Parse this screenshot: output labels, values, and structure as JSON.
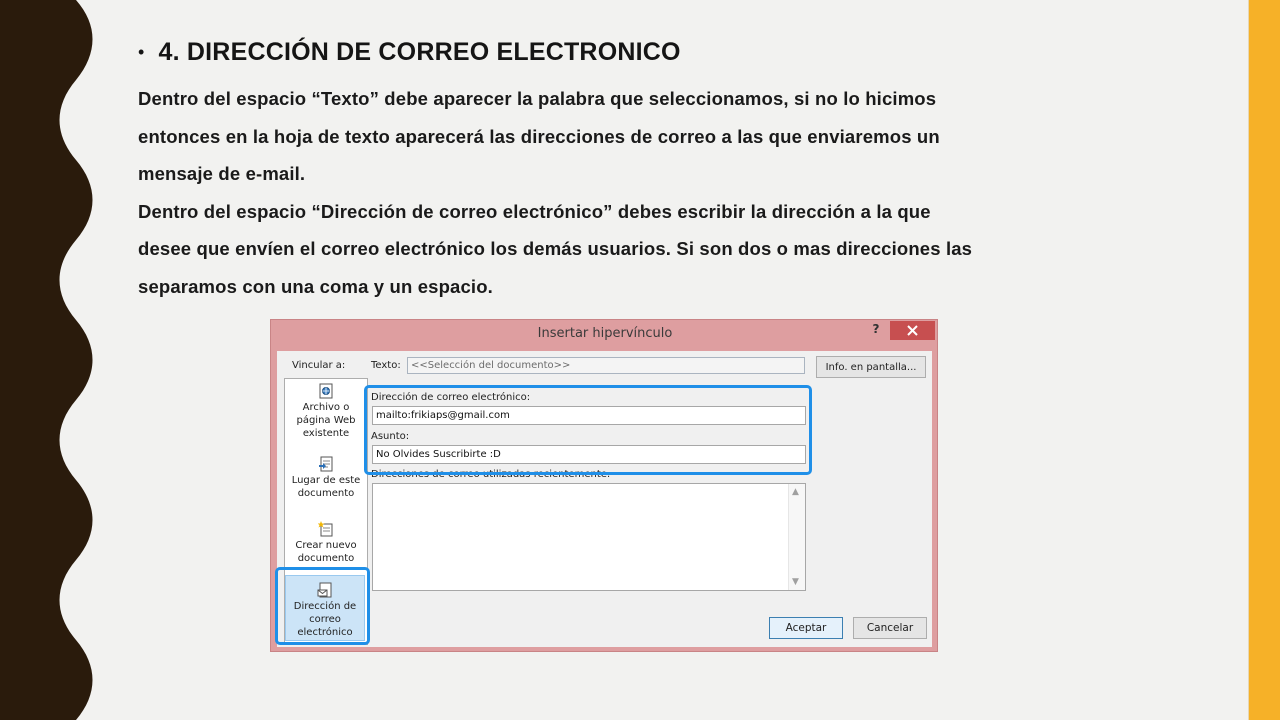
{
  "slide": {
    "heading_bullet": "•",
    "heading": "4. DIRECCIÓN DE CORREO ELECTRONICO",
    "paragraph1_lines": [
      "Dentro del espacio “Texto” debe aparecer la palabra que seleccionamos, si no lo hicimos",
      "entonces en la hoja de texto aparecerá las direcciones de correo a las que enviaremos un",
      "mensaje de e-mail."
    ],
    "paragraph2_lines": [
      "Dentro del espacio “Dirección de correo electrónico” debes escribir la dirección a la que",
      "desee que envíen el correo electrónico los demás usuarios. Si son dos o mas direcciones las",
      "separamos con una coma y un espacio."
    ]
  },
  "dialog": {
    "title": "Insertar hipervínculo",
    "help_label": "?",
    "vincular_label": "Vincular a:",
    "link_targets": [
      {
        "label": "Archivo o página Web existente",
        "icon": "web-page-icon"
      },
      {
        "label": "Lugar de este documento",
        "icon": "document-place-icon"
      },
      {
        "label": "Crear nuevo documento",
        "icon": "new-document-icon"
      },
      {
        "label": "Dirección de correo electrónico",
        "icon": "email-address-icon",
        "selected": true
      }
    ],
    "texto_label": "Texto:",
    "texto_value": "<<Selección del documento>>",
    "info_button": "Info. en pantalla...",
    "email_label": "Dirección de correo electrónico:",
    "email_value": "mailto:frikiaps@gmail.com",
    "asunto_label": "Asunto:",
    "asunto_value": "No Olvides Suscribirte :D",
    "recent_label": "Direcciones de correo utilizadas recientemente:",
    "accept_button": "Aceptar",
    "cancel_button": "Cancelar"
  },
  "colors": {
    "left_border": "#2a1b0c",
    "right_stripe": "#f6b128",
    "highlight": "#1f8fe8",
    "dialog_frame": "#de9ea0",
    "close_button": "#c74f50"
  }
}
